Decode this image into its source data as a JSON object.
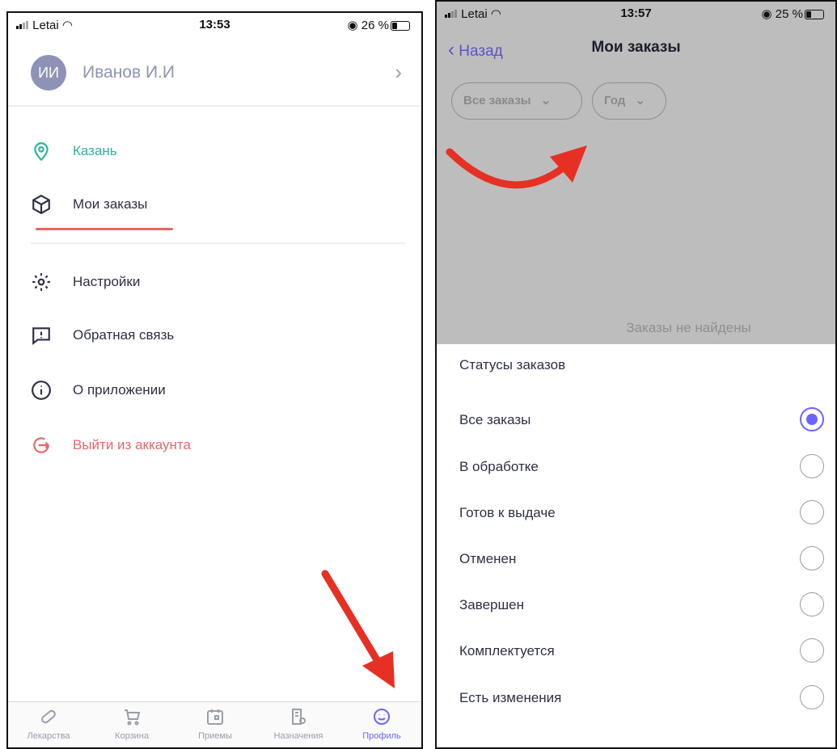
{
  "colors": {
    "accent": "#6c63ff",
    "green": "#2bb39a",
    "logout": "#e8656a",
    "arrow": "#e63024"
  },
  "left": {
    "status": {
      "carrier": "Letai",
      "time": "13:53",
      "battery": "26 %"
    },
    "profile": {
      "initials": "ИИ",
      "name": "Иванов И.И"
    },
    "menu": [
      {
        "label": "Казань",
        "icon": "location-pin-icon"
      },
      {
        "label": "Мои заказы",
        "icon": "box-icon"
      },
      {
        "label": "Настройки",
        "icon": "gear-icon"
      },
      {
        "label": "Обратная связь",
        "icon": "feedback-icon"
      },
      {
        "label": "О приложении",
        "icon": "info-icon"
      },
      {
        "label": "Выйти из аккаунта",
        "icon": "logout-icon"
      }
    ],
    "tabs": [
      {
        "label": "Лекарства",
        "icon": "pill-icon"
      },
      {
        "label": "Корзина",
        "icon": "cart-icon"
      },
      {
        "label": "Приемы",
        "icon": "calendar-icon"
      },
      {
        "label": "Назначения",
        "icon": "prescription-icon"
      },
      {
        "label": "Профиль",
        "icon": "smile-icon"
      }
    ]
  },
  "right": {
    "status": {
      "carrier": "Letai",
      "time": "13:57",
      "battery": "25 %"
    },
    "nav": {
      "back": "Назад",
      "title": "Мои заказы"
    },
    "filters": {
      "status": "Все заказы",
      "period": "Год"
    },
    "empty_text": "Заказы не найдены",
    "sheet": {
      "title": "Статусы заказов",
      "options": [
        {
          "label": "Все заказы",
          "selected": true
        },
        {
          "label": "В обработке",
          "selected": false
        },
        {
          "label": "Готов к выдаче",
          "selected": false
        },
        {
          "label": "Отменен",
          "selected": false
        },
        {
          "label": "Завершен",
          "selected": false
        },
        {
          "label": "Комплектуется",
          "selected": false
        },
        {
          "label": "Есть изменения",
          "selected": false
        }
      ]
    }
  }
}
